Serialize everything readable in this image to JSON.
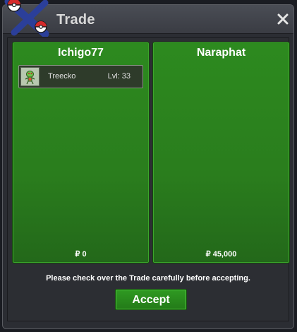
{
  "window": {
    "title": "Trade",
    "close_icon": "close-icon",
    "logo_icon": "pokeball-logo-icon"
  },
  "left_panel": {
    "player_name": "Ichigo77",
    "items": [
      {
        "name": "Treecko",
        "level": "Lvl: 33",
        "icon": "treecko-sprite-icon"
      }
    ],
    "money": "₽ 0"
  },
  "right_panel": {
    "player_name": "Naraphat",
    "items": [],
    "money": "₽ 45,000"
  },
  "footer": {
    "notice": "Please check over the Trade carefully before accepting.",
    "accept_label": "Accept"
  },
  "colors": {
    "panel_green": "#2a7d1d",
    "button_green": "#2f9a22",
    "window_bg": "#2b2d33"
  }
}
